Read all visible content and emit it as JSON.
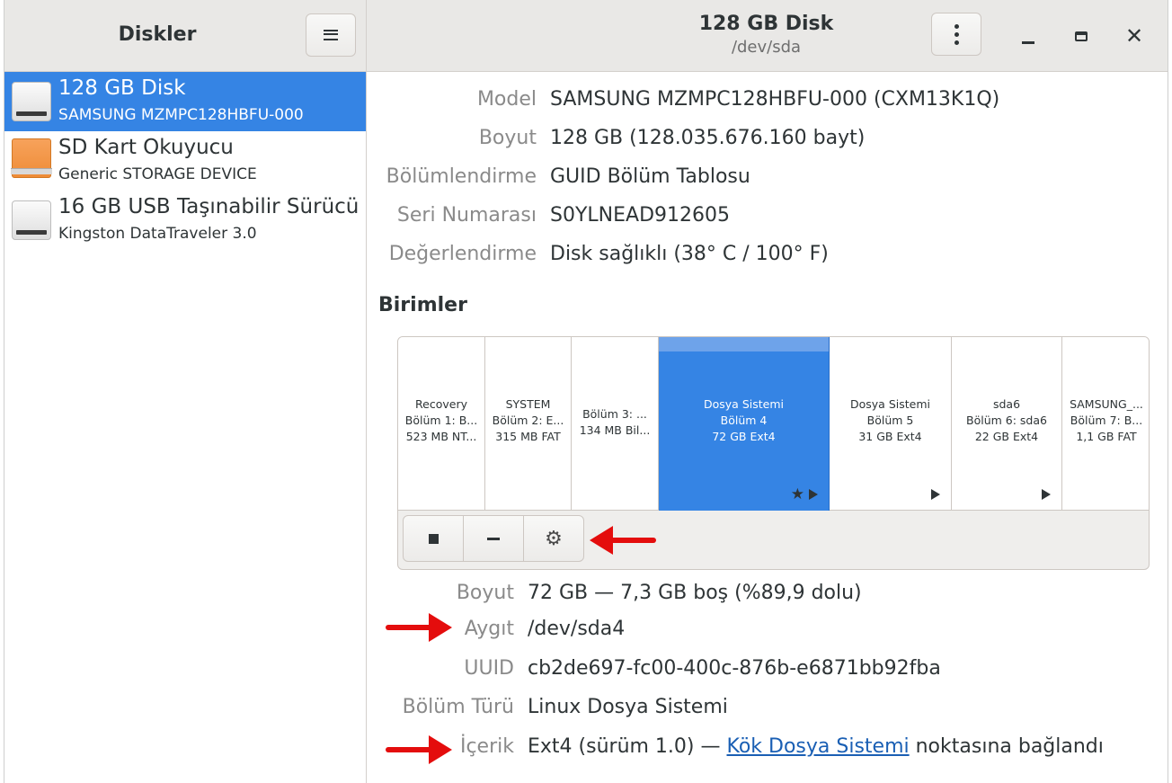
{
  "sidebar": {
    "title": "Diskler",
    "drives": [
      {
        "name": "128 GB Disk",
        "model": "SAMSUNG MZMPC128HBFU-000",
        "icon": "hdd-icon",
        "selected": true
      },
      {
        "name": "SD Kart Okuyucu",
        "model": "Generic STORAGE DEVICE",
        "icon": "sd-card-icon",
        "selected": false
      },
      {
        "name": "16 GB USB Taşınabilir Sürücü",
        "model": "Kingston DataTraveler 3.0",
        "icon": "usb-drive-icon",
        "selected": false
      }
    ]
  },
  "header": {
    "title": "128 GB Disk",
    "subtitle": "/dev/sda"
  },
  "disk_properties": [
    {
      "key": "Model",
      "value": "SAMSUNG MZMPC128HBFU-000 (CXM13K1Q)"
    },
    {
      "key": "Boyut",
      "value": "128 GB (128.035.676.160 bayt)"
    },
    {
      "key": "Bölümlendirme",
      "value": "GUID Bölüm Tablosu"
    },
    {
      "key": "Seri Numarası",
      "value": "S0YLNEAD912605"
    },
    {
      "key": "Değerlendirme",
      "value": "Disk sağlıklı (38° C / 100° F)"
    }
  ],
  "volumes_title": "Birimler",
  "volumes": [
    {
      "line1": "Recovery",
      "line2": "Bölüm 1: B...",
      "line3": "523 MB NT...",
      "selected": false,
      "arrow": false,
      "star": false
    },
    {
      "line1": "SYSTEM",
      "line2": "Bölüm 2: E...",
      "line3": "315 MB FAT",
      "selected": false,
      "arrow": false,
      "star": false
    },
    {
      "line1": "Bölüm 3: ...",
      "line2": "134 MB Bil...",
      "line3": "",
      "selected": false,
      "arrow": false,
      "star": false
    },
    {
      "line1": "Dosya Sistemi",
      "line2": "Bölüm 4",
      "line3": "72 GB Ext4",
      "selected": true,
      "arrow": true,
      "star": true
    },
    {
      "line1": "Dosya Sistemi",
      "line2": "Bölüm 5",
      "line3": "31 GB Ext4",
      "selected": false,
      "arrow": true,
      "star": false
    },
    {
      "line1": "sda6",
      "line2": "Bölüm 6: sda6",
      "line3": "22 GB Ext4",
      "selected": false,
      "arrow": true,
      "star": false
    },
    {
      "line1": "SAMSUNG_...",
      "line2": "Bölüm 7: B...",
      "line3": "1,1 GB FAT",
      "selected": false,
      "arrow": false,
      "star": false
    }
  ],
  "volume_toolbar": [
    "stop-icon",
    "minus-icon",
    "gears-icon"
  ],
  "volume_properties": {
    "size_key": "Boyut",
    "size_value": "72 GB — 7,3 GB boş (%89,9 dolu)",
    "device_key": "Aygıt",
    "device_value": "/dev/sda4",
    "uuid_key": "UUID",
    "uuid_value": "cb2de697-fc00-400c-876b-e6871bb92fba",
    "type_key": "Bölüm Türü",
    "type_value": "Linux Dosya Sistemi",
    "content_key": "İçerik",
    "content_prefix": "Ext4 (sürüm 1.0) — ",
    "content_link": "Kök Dosya Sistemi",
    "content_suffix": " noktasına bağlandı"
  },
  "annotation_color": "#e40d0d",
  "accent_color": "#3584e4"
}
